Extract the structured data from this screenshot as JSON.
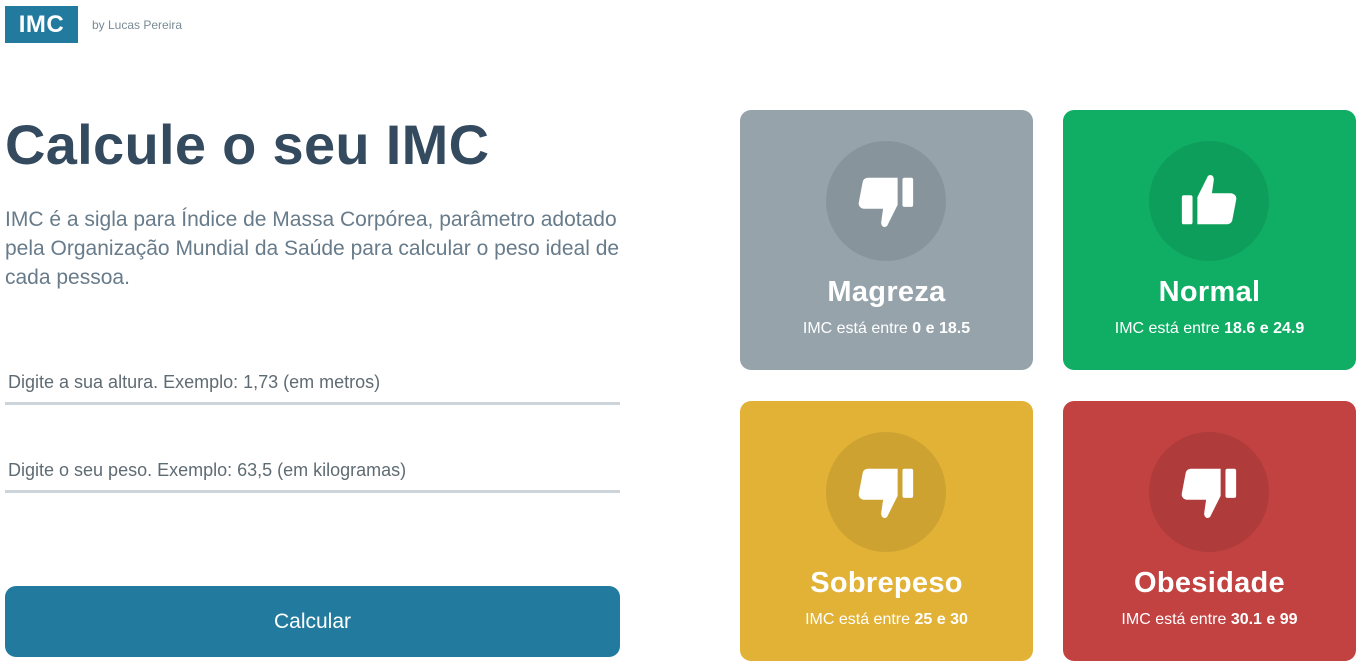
{
  "header": {
    "logo_text": "IMC",
    "author": "by Lucas Pereira"
  },
  "main": {
    "title": "Calcule o seu IMC",
    "description": "IMC é a sigla para Índice de Massa Corpórea, parâmetro adotado pela Organização Mundial da Saúde para calcular o peso ideal de cada pessoa.",
    "height_input": {
      "value": "",
      "placeholder": "Digite a sua altura. Exemplo: 1,73 (em metros)"
    },
    "weight_input": {
      "value": "",
      "placeholder": "Digite o seu peso. Exemplo: 63,5 (em kilogramas)"
    },
    "calculate_label": "Calcular"
  },
  "cards": [
    {
      "title": "Magreza",
      "range_prefix": "IMC está entre",
      "min": "0",
      "joiner": "e",
      "max": "18.5",
      "icon": "thumbs-down-icon",
      "color": "#96a3ab"
    },
    {
      "title": "Normal",
      "range_prefix": "IMC está entre",
      "min": "18.6",
      "joiner": "e",
      "max": "24.9",
      "icon": "thumbs-up-icon",
      "color": "#10ae65"
    },
    {
      "title": "Sobrepeso",
      "range_prefix": "IMC está entre",
      "min": "25",
      "joiner": "e",
      "max": "30",
      "icon": "thumbs-down-icon",
      "color": "#e2b236"
    },
    {
      "title": "Obesidade",
      "range_prefix": "IMC está entre",
      "min": "30.1",
      "joiner": "e",
      "max": "99",
      "icon": "thumbs-down-icon",
      "color": "#c24141"
    }
  ],
  "colors": {
    "accent": "#227b9e",
    "title_text": "#344a5e",
    "body_text": "#677b8a"
  }
}
